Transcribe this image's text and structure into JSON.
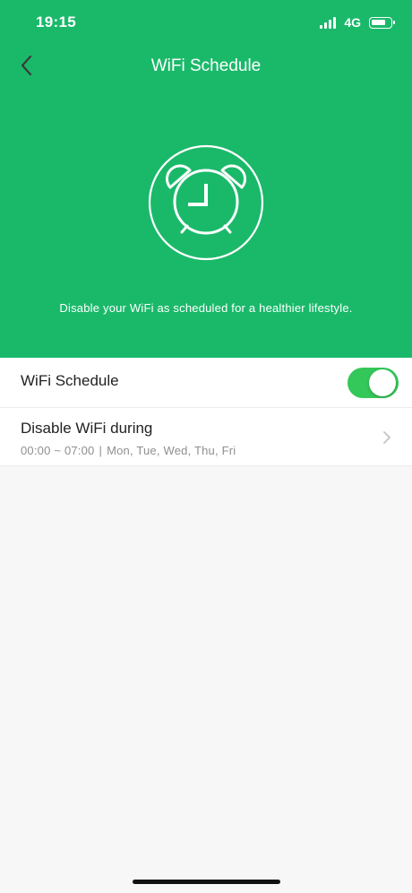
{
  "status_bar": {
    "time": "19:15",
    "network": "4G"
  },
  "header": {
    "title": "WiFi Schedule",
    "back_icon": "chevron-left-icon"
  },
  "hero": {
    "icon": "alarm-clock-icon",
    "description": "Disable your WiFi as scheduled for a healthier lifestyle."
  },
  "settings": {
    "toggle_row": {
      "label": "WiFi Schedule",
      "enabled": true
    },
    "schedule_row": {
      "label": "Disable WiFi during",
      "time_range": "00:00 ~ 07:00",
      "separator": "|",
      "days": "Mon, Tue, Wed, Thu, Fri"
    }
  },
  "colors": {
    "accent": "#1ab96a",
    "toggle_on": "#34c759",
    "background": "#f7f7f7"
  }
}
